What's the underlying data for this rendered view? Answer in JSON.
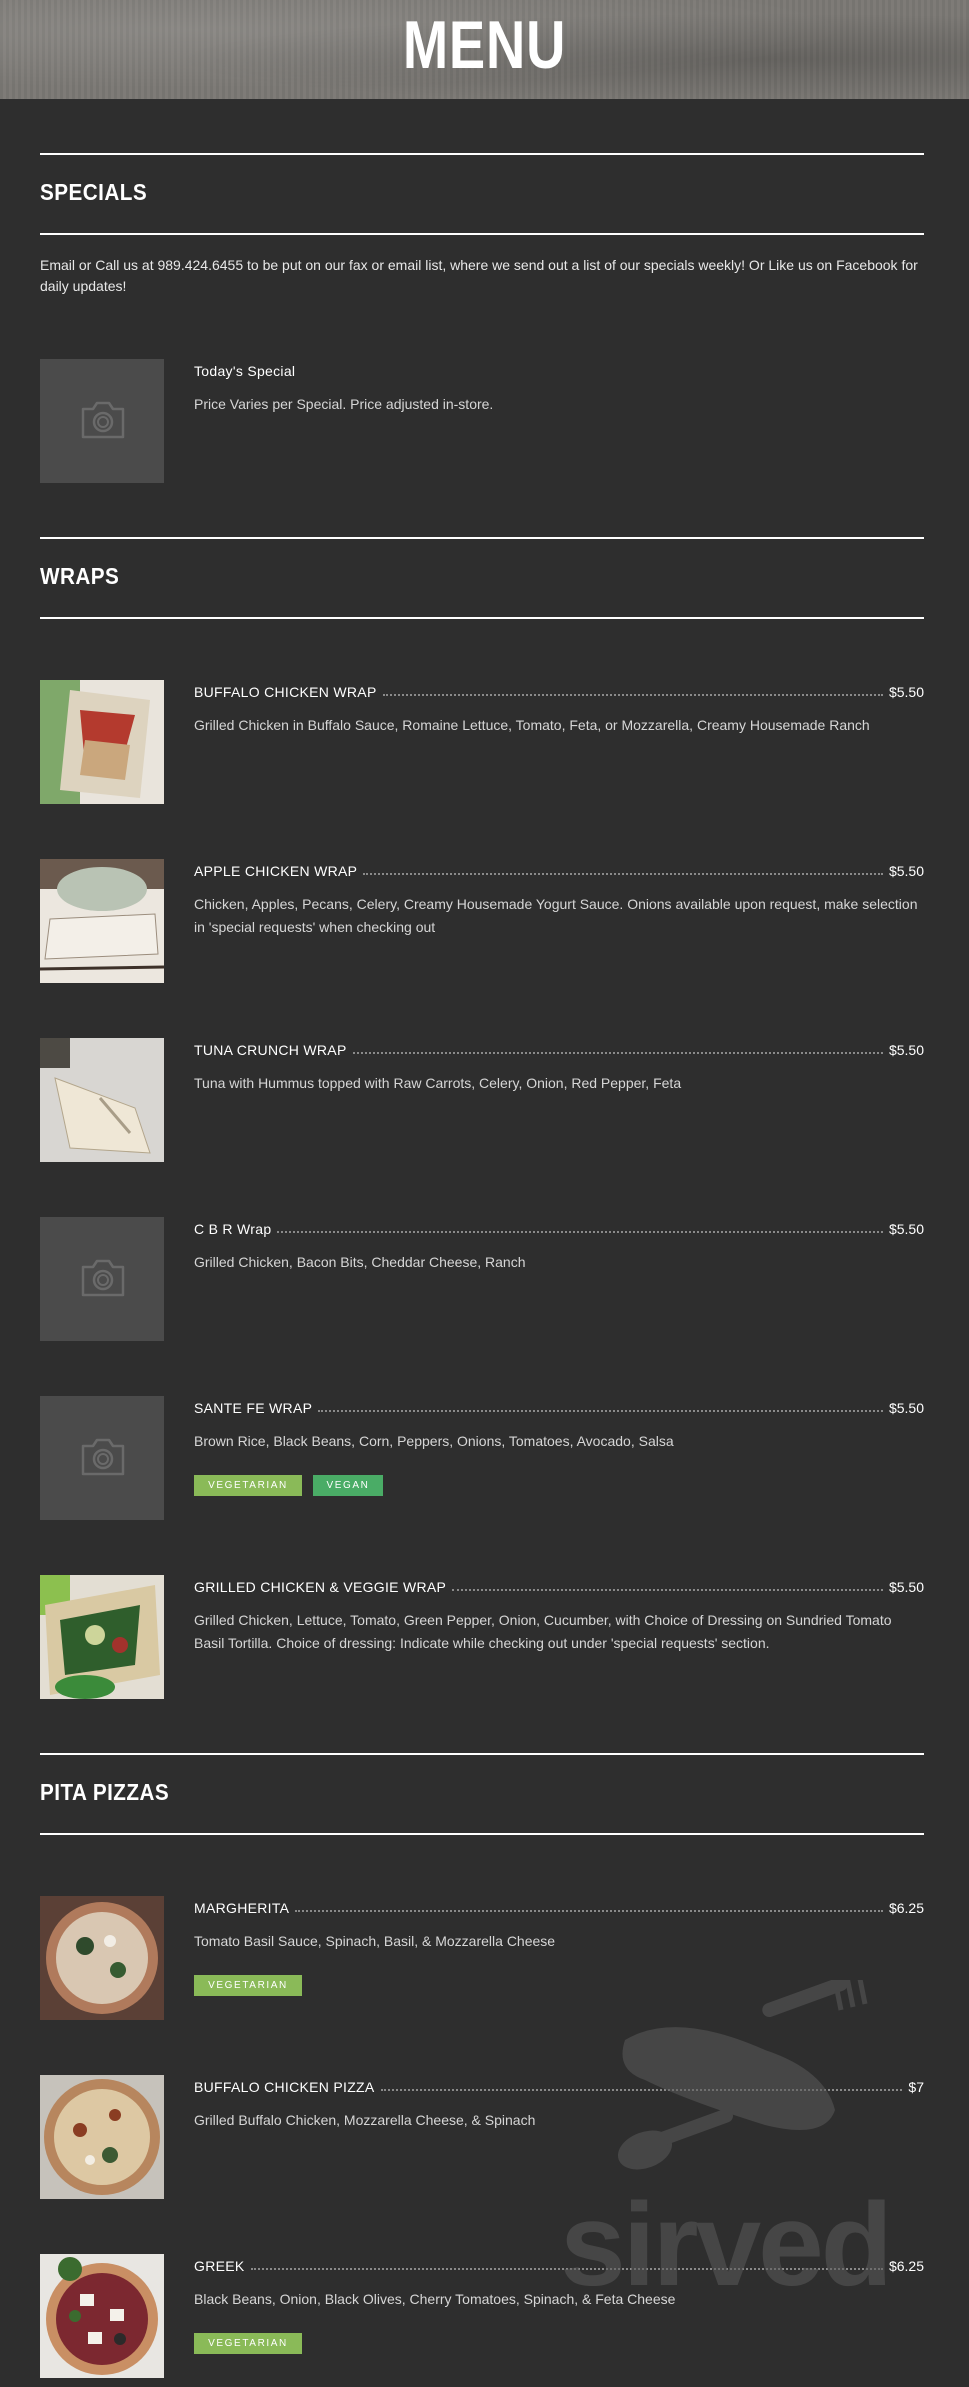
{
  "header": {
    "title": "MENU"
  },
  "sections": {
    "specials": {
      "title": "SPECIALS",
      "intro": "Email or Call us at 989.424.6455 to be put on our fax or email list, where we send out a list of our specials weekly! Or Like us on Facebook for daily updates!",
      "items": [
        {
          "name": "Today's Special",
          "price": "",
          "desc": "Price Varies per Special. Price adjusted in-store."
        }
      ]
    },
    "wraps": {
      "title": "WRAPS",
      "items": [
        {
          "name": "BUFFALO CHICKEN WRAP",
          "price": "$5.50",
          "desc": "Grilled Chicken in Buffalo Sauce, Romaine Lettuce, Tomato, Feta, or Mozzarella, Creamy Housemade Ranch"
        },
        {
          "name": "APPLE CHICKEN WRAP",
          "price": "$5.50",
          "desc": "Chicken, Apples, Pecans, Celery, Creamy Housemade Yogurt Sauce. Onions available upon request, make selection in 'special requests' when checking out"
        },
        {
          "name": "TUNA CRUNCH WRAP",
          "price": "$5.50",
          "desc": "Tuna with Hummus topped with Raw Carrots, Celery, Onion, Red Pepper, Feta"
        },
        {
          "name": "C B R Wrap",
          "price": "$5.50",
          "desc": "Grilled Chicken, Bacon Bits, Cheddar Cheese, Ranch"
        },
        {
          "name": "SANTE FE WRAP",
          "price": "$5.50",
          "desc": "Brown Rice, Black Beans, Corn, Peppers, Onions, Tomatoes, Avocado, Salsa",
          "tags": [
            "VEGETARIAN",
            "VEGAN"
          ]
        },
        {
          "name": "GRILLED CHICKEN & VEGGIE WRAP",
          "price": "$5.50",
          "desc": "Grilled Chicken, Lettuce, Tomato, Green Pepper, Onion, Cucumber, with Choice of Dressing on Sundried Tomato Basil Tortilla. Choice of dressing: Indicate while checking out under 'special requests' section."
        }
      ]
    },
    "pita": {
      "title": "PITA PIZZAS",
      "items": [
        {
          "name": "MARGHERITA",
          "price": "$6.25",
          "desc": "Tomato Basil Sauce, Spinach, Basil, & Mozzarella Cheese",
          "tags": [
            "VEGETARIAN"
          ]
        },
        {
          "name": "BUFFALO CHICKEN PIZZA",
          "price": "$7",
          "desc": "Grilled Buffalo Chicken, Mozzarella Cheese, & Spinach"
        },
        {
          "name": "GREEK",
          "price": "$6.25",
          "desc": "Black Beans, Onion, Black Olives, Cherry Tomatoes, Spinach, & Feta Cheese",
          "tags": [
            "VEGETARIAN"
          ]
        }
      ]
    }
  },
  "watermark": {
    "text": "sirved"
  },
  "colors": {
    "background": "#2e2e2e",
    "vegetarian": "#8aba58",
    "vegan": "#4aac66"
  },
  "icons": {
    "placeholder": "camera-icon",
    "watermark": "fork-knife-logo"
  }
}
